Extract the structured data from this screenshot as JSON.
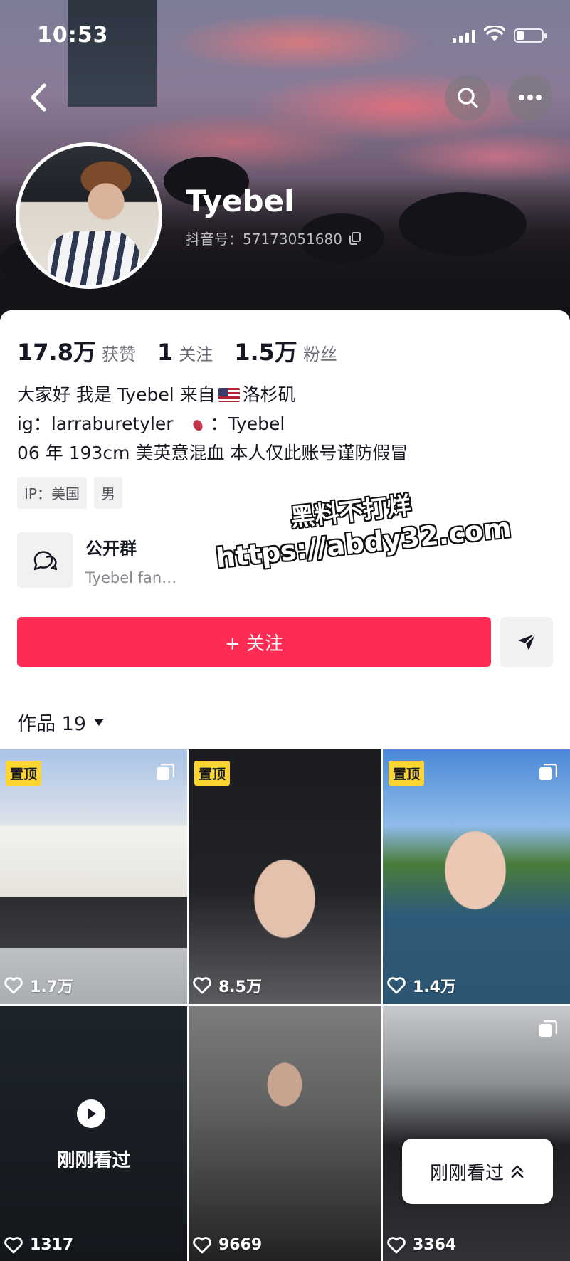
{
  "status_bar": {
    "time": "10:53"
  },
  "profile": {
    "name": "Tyebel",
    "douyin_id": "抖音号：57173051680",
    "stats": [
      {
        "value": "17.8万",
        "label": "获赞"
      },
      {
        "value": "1",
        "label": "关注"
      },
      {
        "value": "1.5万",
        "label": "粉丝"
      }
    ],
    "bio": {
      "line1_a": "大家好 我是 Tyebel 来自",
      "line1_b": "洛杉矶",
      "line2_a": "ig：larraburetyler",
      "line2_b": "：Tyebel",
      "line3": "06 年 193cm 美英意混血 本人仅此账号谨防假冒"
    },
    "tags": [
      "IP：美国",
      "男"
    ],
    "group": {
      "title": "公开群",
      "subtitle": "Tyebel fan…"
    }
  },
  "actions": {
    "follow_label": "+ 关注"
  },
  "works": {
    "label": "作品 19"
  },
  "grid": [
    {
      "pinned": "置顶",
      "likes": "1.7万",
      "multi": true
    },
    {
      "pinned": "置顶",
      "likes": "8.5万",
      "multi": false
    },
    {
      "pinned": "置顶",
      "likes": "1.4万",
      "multi": true
    },
    {
      "pinned": "",
      "likes": "1317",
      "overlay": "刚刚看过",
      "multi": false
    },
    {
      "pinned": "",
      "likes": "9669",
      "multi": false
    },
    {
      "pinned": "",
      "likes": "3364",
      "multi": true
    }
  ],
  "floating": {
    "label": "刚刚看过"
  },
  "watermark": {
    "line1": "黑料不打烊",
    "line2": "https://abdy32.com"
  },
  "colors": {
    "accent": "#fe2c55",
    "pin": "#fcd531"
  }
}
